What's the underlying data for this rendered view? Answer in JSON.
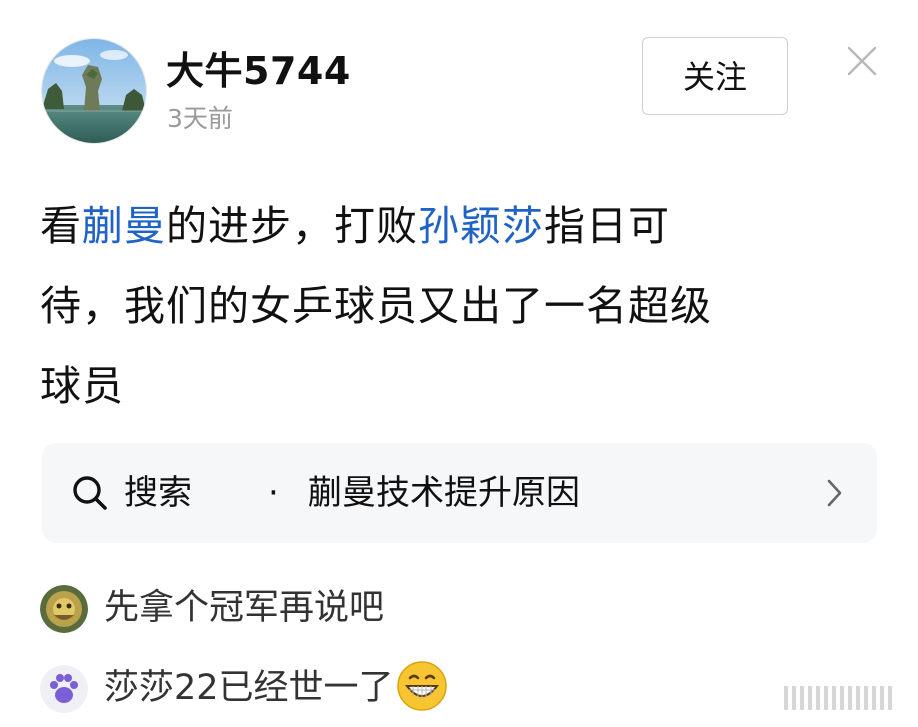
{
  "header": {
    "username": "大牛5744",
    "time": "3天前",
    "follow_label": "关注"
  },
  "post": {
    "segments": [
      {
        "text": "看",
        "type": "plain"
      },
      {
        "text": "蒯曼",
        "type": "mention"
      },
      {
        "text": "的进步，打败",
        "type": "plain"
      },
      {
        "text": "孙颖莎",
        "type": "mention"
      },
      {
        "text": "指日可",
        "type": "plain"
      },
      {
        "text": "待，我们的女乒球员又出了一名超级",
        "type": "plain"
      },
      {
        "text": "球员",
        "type": "plain"
      }
    ]
  },
  "search": {
    "label": "搜索",
    "separator": "·",
    "query": "蒯曼技术提升原因"
  },
  "comments": [
    {
      "text": "先拿个冠军再说吧"
    },
    {
      "text": "莎莎22已经世一了"
    }
  ],
  "colors": {
    "mention": "#1f63c4",
    "muted": "#9a9a9a",
    "search_bg": "#f6f7f9"
  }
}
